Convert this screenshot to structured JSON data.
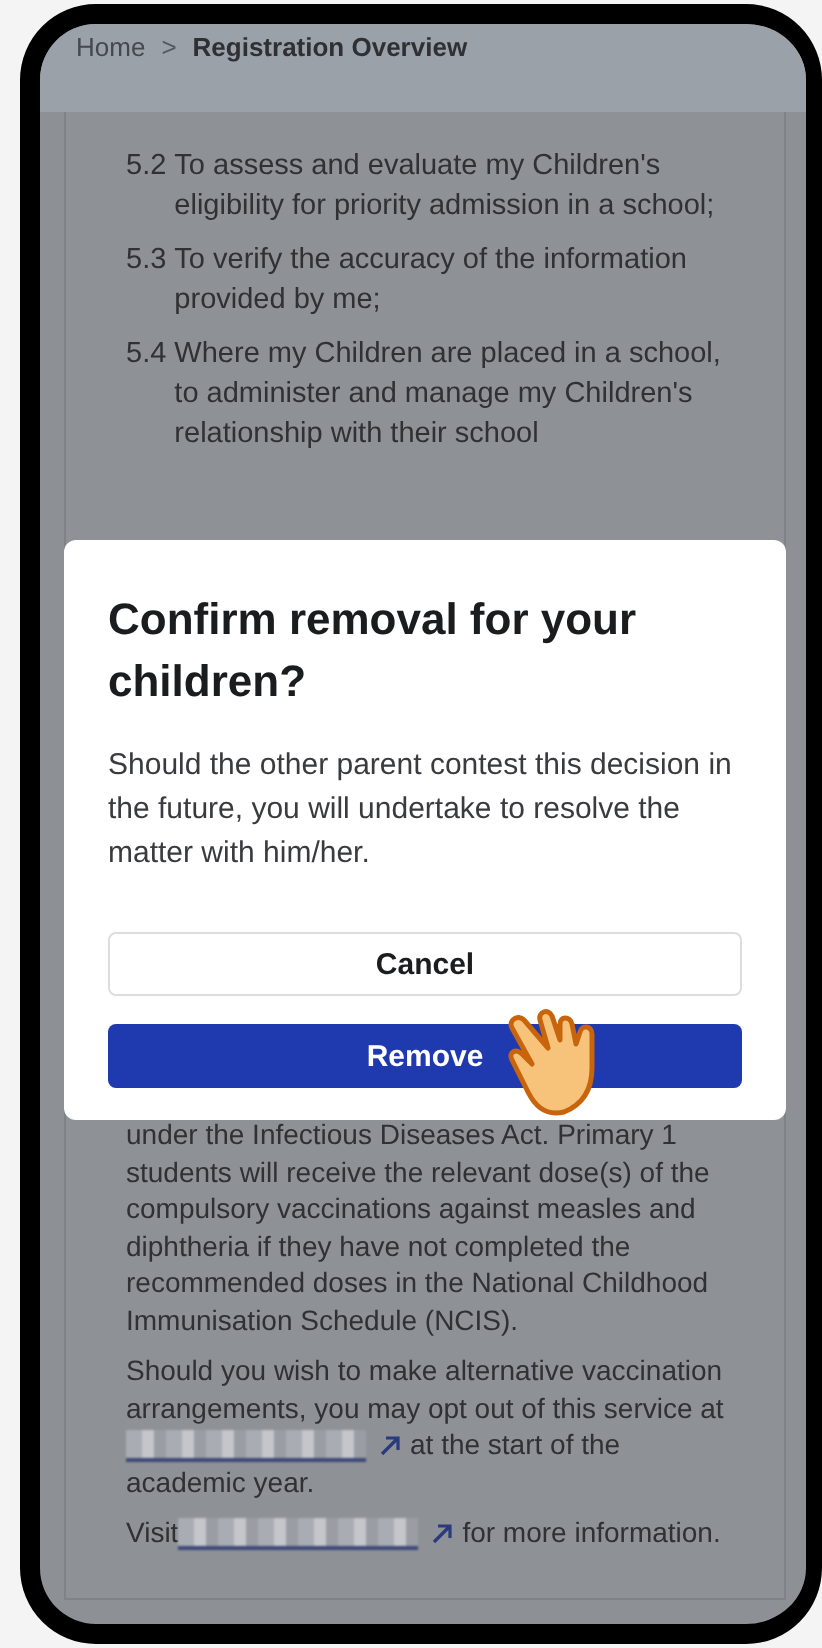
{
  "breadcrumb": [
    {
      "label": "Home"
    },
    {
      "label": "Registration Overview"
    }
  ],
  "separator": ">",
  "clauses": [
    {
      "number": "5.2",
      "text": "To assess and evaluate my Children's eligibility for priority admission in a school;"
    },
    {
      "number": "5.3",
      "text": "To verify the accuracy of the information provided by me;"
    },
    {
      "number": "5.4",
      "text": "Where my Children are placed in a school, to administer and manage my Children's relationship with their school"
    }
  ],
  "paragraphs": [
    {
      "before": "under the Infectious Diseases Act. Primary 1 students will receive the relevant dose(s) of the compulsory vaccinations against measles and diphtheria if they have not completed the recommended doses in the National Childhood Immunisation Schedule (NCIS).",
      "has_link": false
    },
    {
      "before": "Should you wish to make alternative vaccination arrangements, you may opt out of this service at",
      "has_link": true,
      "after": "at the start of the academic year."
    },
    {
      "before": "Visit",
      "has_link": true,
      "after": "for more information."
    }
  ],
  "dialog": {
    "title": "Confirm removal for your children?",
    "message": "Should the other parent contest this decision in the future, you will undertake to resolve the matter with him/her.",
    "buttons": [
      {
        "label": "Cancel",
        "kind": "secondary"
      },
      {
        "label": "Remove",
        "kind": "primary"
      }
    ]
  }
}
